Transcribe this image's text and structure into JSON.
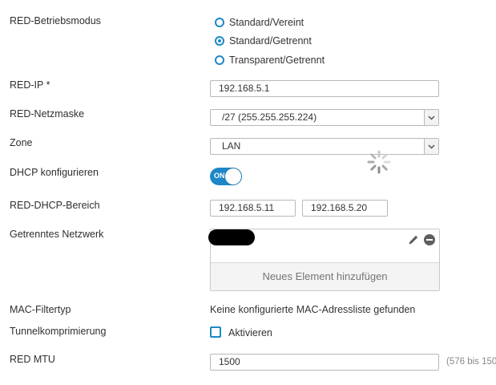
{
  "labels": {
    "mode": "RED-Betriebsmodus",
    "red_ip": "RED-IP *",
    "netmask": "RED-Netzmaske",
    "zone": "Zone",
    "dhcp": "DHCP konfigurieren",
    "dhcp_range": "RED-DHCP-Bereich",
    "separate_net": "Getrenntes Netzwerk",
    "mac_filter": "MAC-Filtertyp",
    "tunnel": "Tunnelkomprimierung",
    "mtu": "RED MTU"
  },
  "mode_options": [
    {
      "label": "Standard/Vereint",
      "checked": false
    },
    {
      "label": "Standard/Getrennt",
      "checked": true
    },
    {
      "label": "Transparent/Getrennt",
      "checked": false
    }
  ],
  "red_ip_value": "192.168.5.1",
  "netmask_value": "/27 (255.255.255.224)",
  "zone_value": "LAN",
  "dhcp_toggle": {
    "label": "ON",
    "on": true
  },
  "dhcp_range": {
    "start": "192.168.5.11",
    "end": "192.168.5.20"
  },
  "separate_network": {
    "add_label": "Neues Element hinzufügen"
  },
  "mac_filter_text": "Keine konfigurierte MAC-Adressliste gefunden",
  "tunnel_checkbox_label": "Aktivieren",
  "mtu_value": "1500",
  "mtu_hint": "(576 bis 150",
  "colors": {
    "accent": "#1e88c7",
    "label": "#2f2f2f",
    "border": "#b9b9b9"
  },
  "icons": [
    "chevron-down-icon",
    "spinner-icon",
    "pencil-icon",
    "remove-icon"
  ]
}
